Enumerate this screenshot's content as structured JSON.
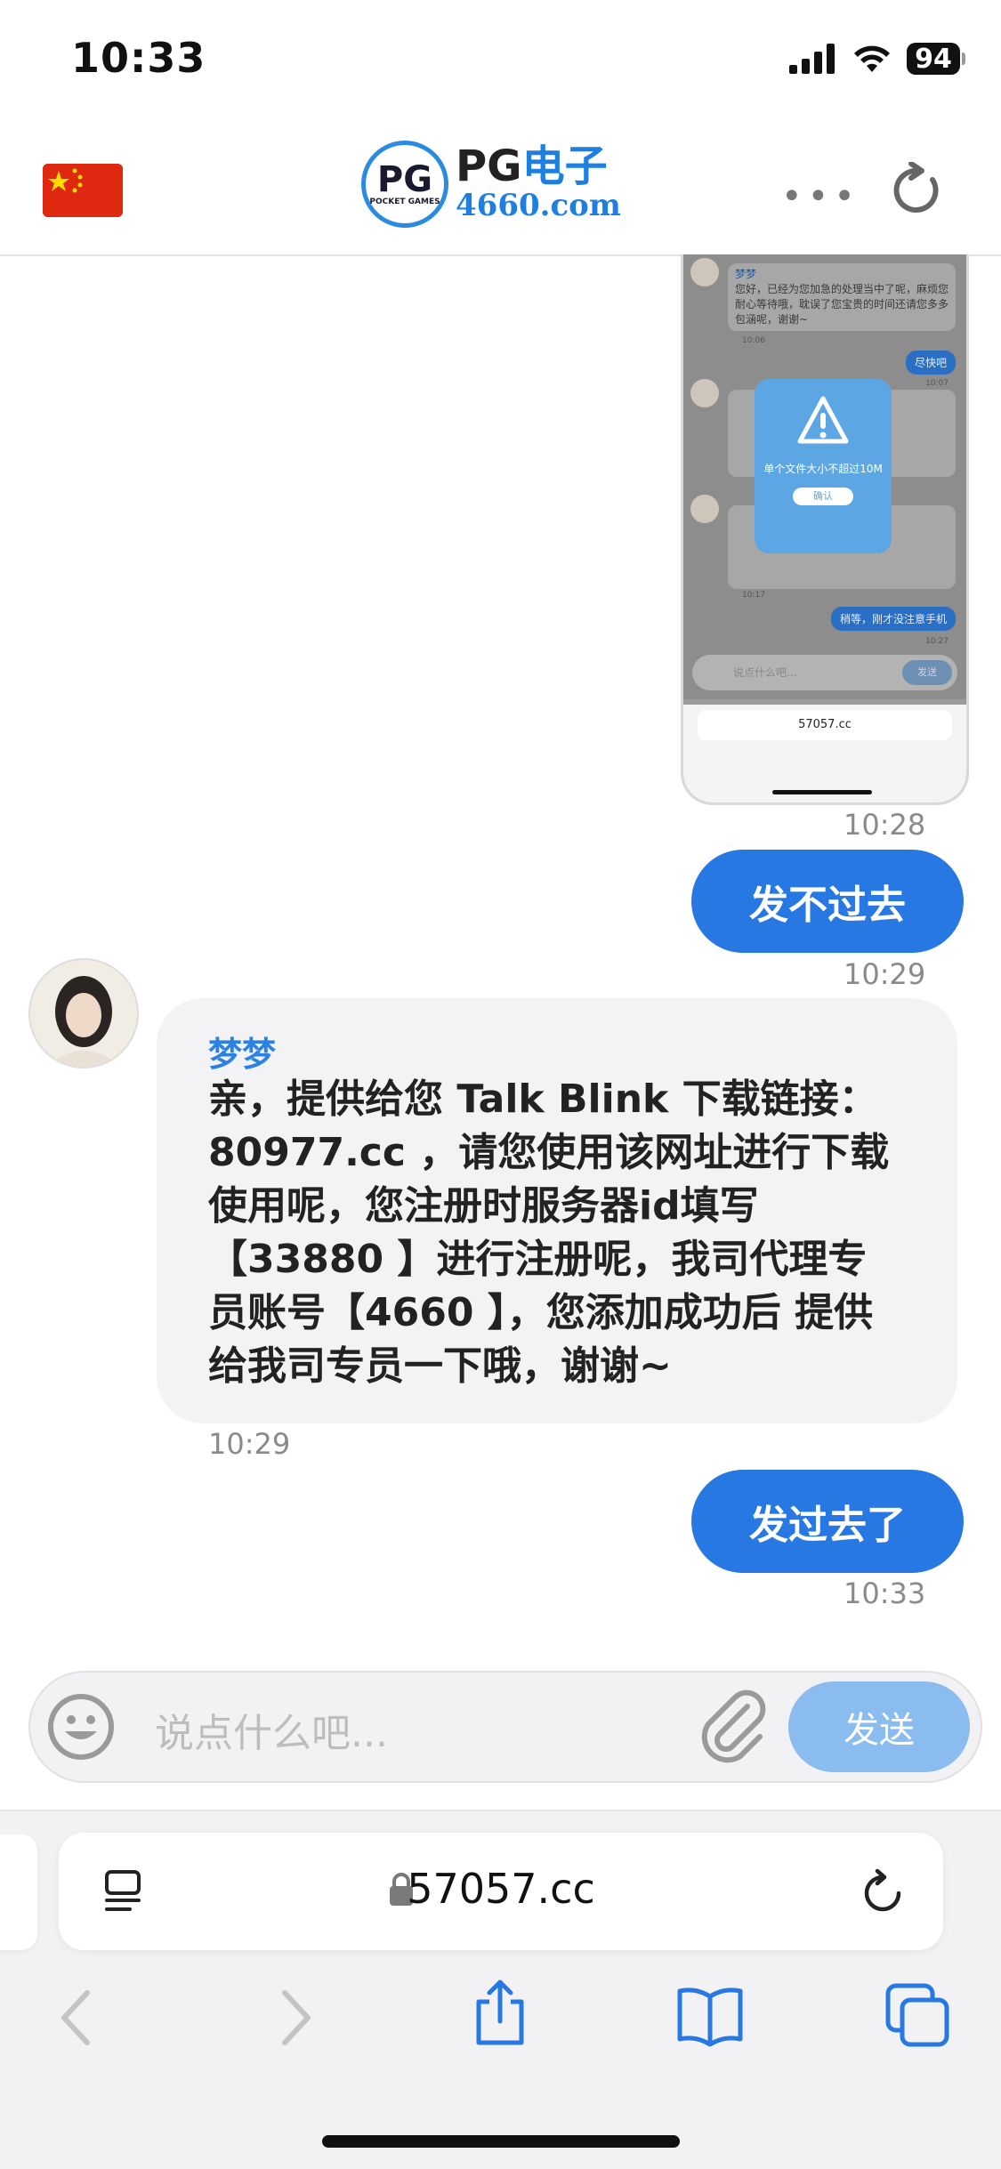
{
  "status": {
    "time": "10:33",
    "battery": "94"
  },
  "header": {
    "logo_mark": "PG",
    "logo_mark_sub": "POCKET GAMES",
    "logo_pg": "PG",
    "logo_dz": "电子",
    "logo_domain": "4660.com",
    "more": "•••"
  },
  "messages": [
    {
      "type": "image",
      "time": "10:28"
    },
    {
      "type": "sent",
      "text": "发不过去",
      "time": "10:29"
    },
    {
      "type": "received",
      "name": "梦梦",
      "text": "亲，提供给您 Talk Blink 下载链接： 80977.cc ，请您使用该网址进行下载使用呢，您注册时服务器id填写【33880 】进行注册呢，我司代理专员账号【4660 】，您添加成功后 提供给我司专员一下哦，谢谢~",
      "time": "10:29"
    },
    {
      "type": "sent",
      "text": "发过去了",
      "time": "10:33"
    }
  ],
  "screenshot": {
    "name1": "梦梦",
    "text1": "您好，已经为您加急的处理当中了呢，麻烦您耐心等待哦，耽误了您宝贵的时间还请您多多包涵呢，谢谢~",
    "time1": "10:06",
    "blue1": "尽快吧",
    "time2": "10:07",
    "alert_text": "单个文件大小不超过10M",
    "alert_ok": "确认",
    "time3": "10:17",
    "blue2": "稍等，刚才没注意手机",
    "time4": "10:27",
    "placeholder": "说点什么吧...",
    "send": "发送",
    "url": "57057.cc"
  },
  "composer": {
    "placeholder": "说点什么吧...",
    "send_label": "发送"
  },
  "browser": {
    "url": "57057.cc"
  }
}
